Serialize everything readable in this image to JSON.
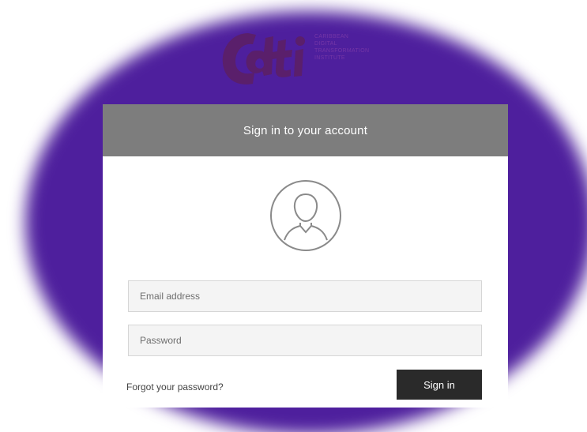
{
  "brand": {
    "logo_text": "Cdti",
    "logo_subtext_lines": [
      "CARIBBEAN",
      "DIGITAL",
      "TRANSFORMATION",
      "INSTITUTE"
    ],
    "logo_color": "#5a1f6b",
    "backdrop_color": "#4e1f9d"
  },
  "login": {
    "header_title": "Sign in to your account",
    "avatar_icon": "user-avatar-icon",
    "email": {
      "placeholder": "Email address",
      "value": ""
    },
    "password": {
      "placeholder": "Password",
      "value": ""
    },
    "forgot_link": "Forgot your password?",
    "submit_label": "Sign in",
    "header_color": "#7d7d7d",
    "button_color": "#2a2a2a"
  }
}
